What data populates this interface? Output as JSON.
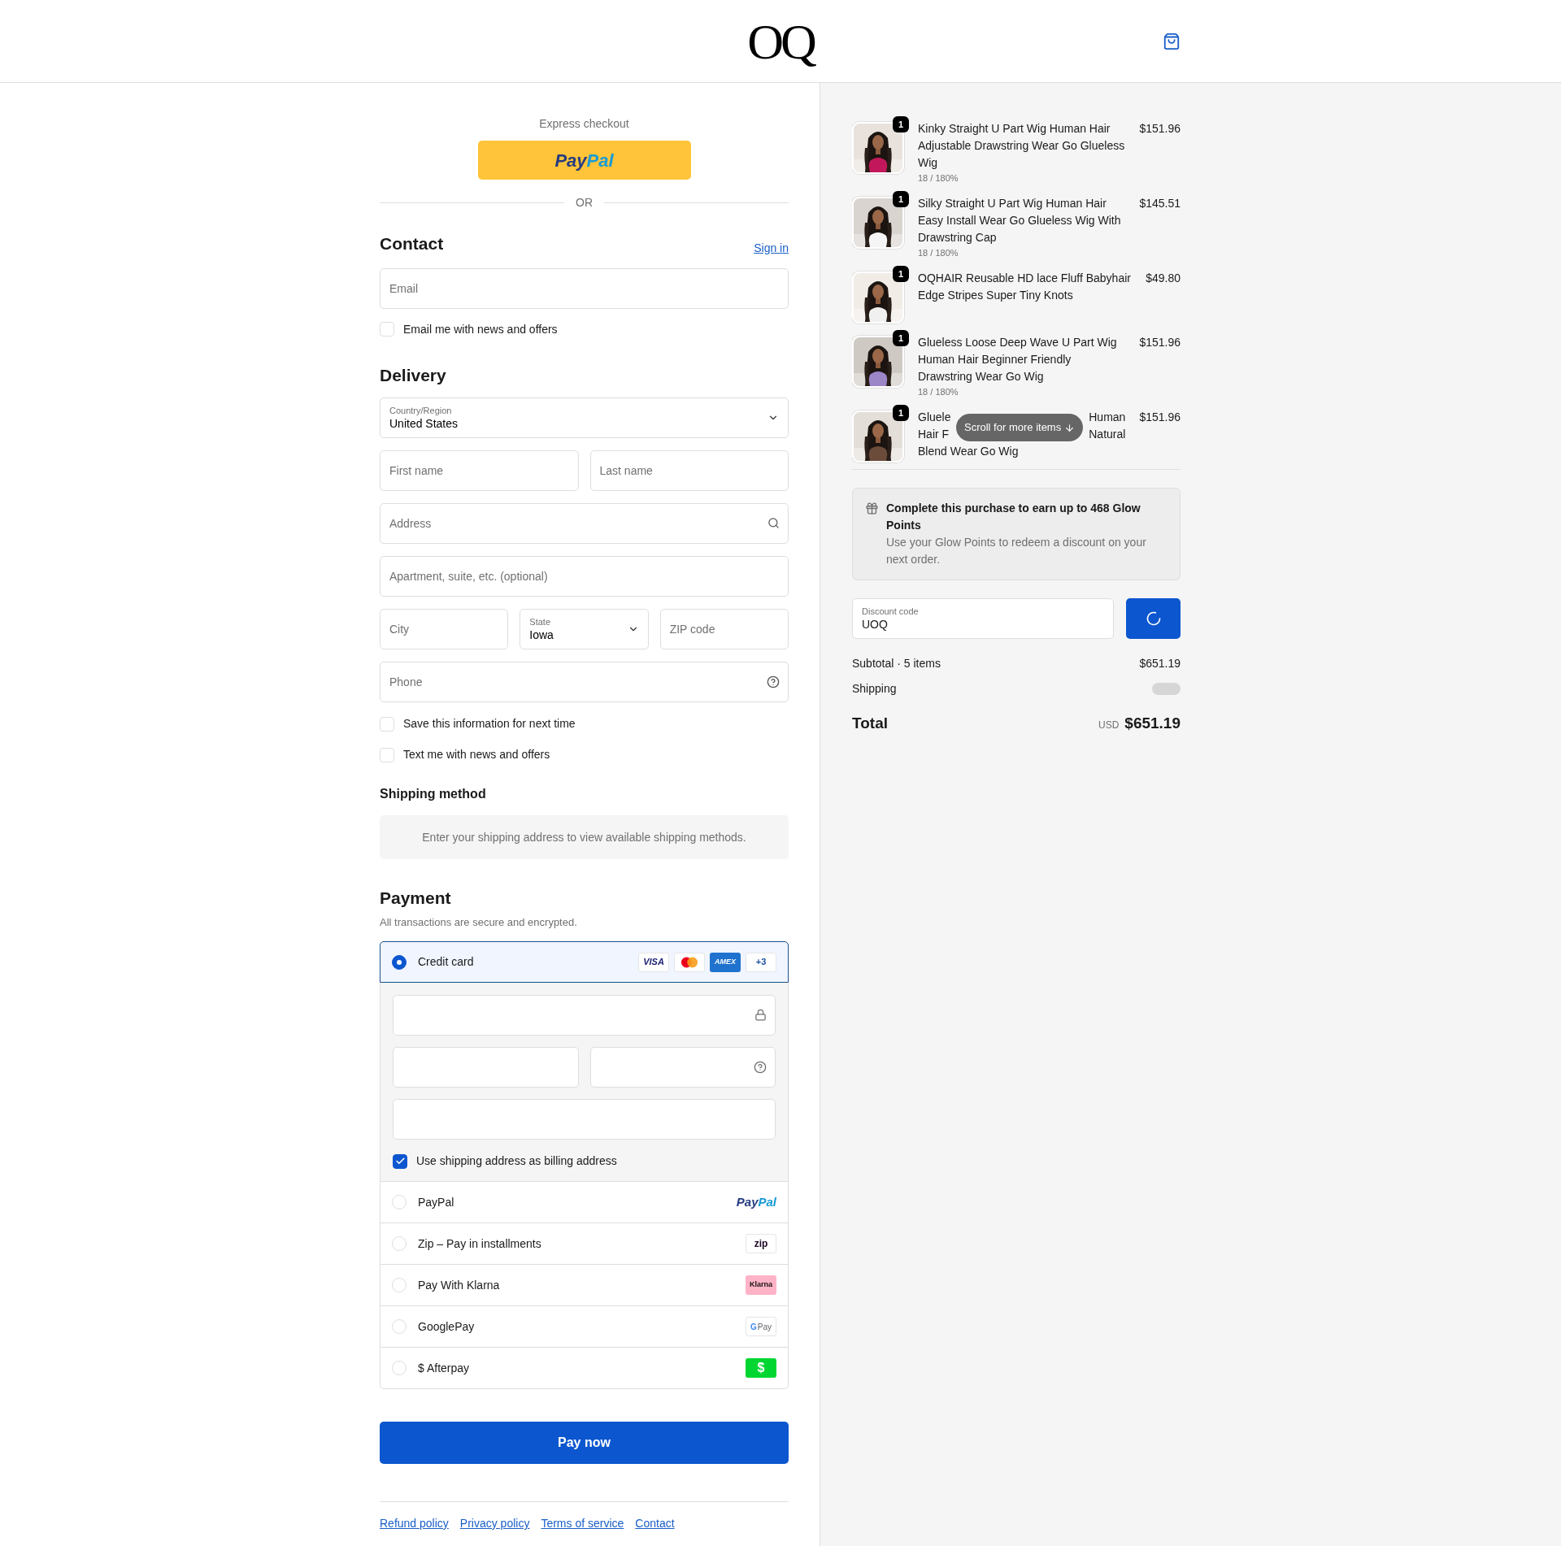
{
  "header": {
    "logo": "OQ"
  },
  "express": {
    "label": "Express checkout",
    "paypal_button": {
      "pay": "Pay",
      "pal": "Pal"
    },
    "divider": "OR"
  },
  "contact": {
    "title": "Contact",
    "sign_in": "Sign in",
    "email": {
      "placeholder": "Email"
    },
    "news": {
      "label": "Email me with news and offers",
      "checked": false
    }
  },
  "delivery": {
    "title": "Delivery",
    "country": {
      "label": "Country/Region",
      "value": "United States"
    },
    "first_name": {
      "placeholder": "First name"
    },
    "last_name": {
      "placeholder": "Last name"
    },
    "address": {
      "placeholder": "Address"
    },
    "apartment": {
      "placeholder": "Apartment, suite, etc. (optional)"
    },
    "city": {
      "placeholder": "City"
    },
    "state": {
      "label": "State",
      "value": "Iowa"
    },
    "zip": {
      "placeholder": "ZIP code"
    },
    "phone": {
      "placeholder": "Phone"
    },
    "options": [
      {
        "label": "Save this information for next time",
        "checked": false
      },
      {
        "label": "Text me with news and offers",
        "checked": false
      }
    ]
  },
  "shipping_method": {
    "title": "Shipping method",
    "notice": "Enter your shipping address to view available shipping methods."
  },
  "payment": {
    "title": "Payment",
    "subtitle": "All transactions are secure and encrypted.",
    "methods": [
      {
        "kind": "card",
        "label": "Credit card",
        "selected": true,
        "brands": [
          {
            "kind": "visa",
            "text": "VISA"
          },
          {
            "kind": "mastercard"
          },
          {
            "kind": "amex",
            "text": "AMEX"
          },
          {
            "kind": "more",
            "text": "+3"
          }
        ],
        "billing": {
          "label": "Use shipping address as billing address",
          "checked": true
        }
      },
      {
        "kind": "paypal",
        "label": "PayPal",
        "selected": false,
        "logo": [
          "Pay",
          "Pal"
        ]
      },
      {
        "kind": "zip",
        "label": "Zip – Pay in installments",
        "selected": false,
        "logo": [
          "zip"
        ]
      },
      {
        "kind": "klarna",
        "label": "Pay With Klarna",
        "selected": false,
        "logo": [
          "Klarna"
        ]
      },
      {
        "kind": "gpay",
        "label": "GooglePay",
        "selected": false,
        "logo": [
          "G",
          "Pay"
        ]
      },
      {
        "kind": "afterpay",
        "label": "$ Afterpay",
        "selected": false,
        "logo": [
          "$"
        ]
      }
    ]
  },
  "pay_button": "Pay now",
  "footer_links": [
    "Refund policy",
    "Privacy policy",
    "Terms of service",
    "Contact"
  ],
  "summary": {
    "items": [
      {
        "quantity": "1",
        "title": "Kinky Straight U Part Wig Human Hair Adjustable Drawstring Wear Go Glueless Wig",
        "variant": "18 / 180%",
        "price": "$151.96"
      },
      {
        "quantity": "1",
        "title": "Silky Straight U Part Wig Human Hair Easy Install Wear Go Glueless Wig With Drawstring Cap",
        "variant": "18 / 180%",
        "price": "$145.51"
      },
      {
        "quantity": "1",
        "title": "OQHAIR Reusable HD lace Fluff Babyhair Edge Stripes Super Tiny Knots",
        "price": "$49.80"
      },
      {
        "quantity": "1",
        "title": "Glueless Loose Deep Wave U Part Wig Human Hair Beginner Friendly Drawstring Wear Go Wig",
        "variant": "18 / 180%",
        "price": "$151.96"
      },
      {
        "quantity": "1",
        "title_fragments": [
          [
            "Gluele",
            "Human"
          ],
          [
            "Hair F",
            "Natural"
          ],
          [
            "Blend Wear Go Wig"
          ]
        ],
        "price": "$151.96"
      }
    ],
    "scroll_hint": "Scroll for more items",
    "rewards": {
      "title": "Complete this purchase to earn up to 468 Glow Points",
      "text": "Use your Glow Points to redeem a discount on your next order."
    },
    "discount": {
      "label": "Discount code",
      "value": "UOQ"
    },
    "subtotal": {
      "label": "Subtotal · 5 items",
      "value": "$651.19"
    },
    "shipping": {
      "label": "Shipping"
    },
    "total": {
      "label": "Total",
      "currency": "USD",
      "value": "$651.19"
    }
  }
}
